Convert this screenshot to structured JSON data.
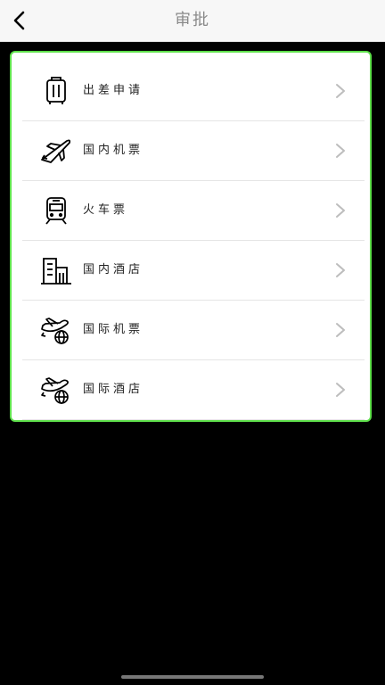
{
  "header": {
    "title": "审批"
  },
  "menu": {
    "items": [
      {
        "label": "出差申请",
        "icon": "suitcase-icon"
      },
      {
        "label": "国内机票",
        "icon": "airplane-icon"
      },
      {
        "label": "火车票",
        "icon": "train-icon"
      },
      {
        "label": "国内酒店",
        "icon": "building-icon"
      },
      {
        "label": "国际机票",
        "icon": "international-flight-icon"
      },
      {
        "label": "国际酒店",
        "icon": "international-hotel-icon"
      }
    ]
  },
  "colors": {
    "card_border": "#5ee04b",
    "header_bg": "#f7f7f7",
    "title": "#8a8a8a"
  }
}
